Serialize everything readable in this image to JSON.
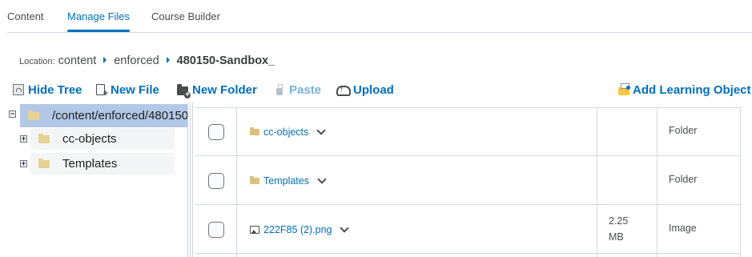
{
  "tabs": [
    {
      "label": "Content",
      "active": false
    },
    {
      "label": "Manage Files",
      "active": true
    },
    {
      "label": "Course Builder",
      "active": false
    }
  ],
  "breadcrumb": {
    "location_label": "Location:",
    "items": [
      "content",
      "enforced",
      "480150-Sandbox_"
    ]
  },
  "toolbar": {
    "hide_tree": "Hide Tree",
    "new_file": "New File",
    "new_folder": "New Folder",
    "paste": "Paste",
    "upload": "Upload",
    "add_learning_object": "Add Learning Object"
  },
  "tree": {
    "root": "/content/enforced/480150",
    "children": [
      "cc-objects",
      "Templates"
    ]
  },
  "files": [
    {
      "name": "cc-objects",
      "icon": "folder-icon",
      "size": "",
      "type": "Folder"
    },
    {
      "name": "Templates",
      "icon": "folder-icon",
      "size": "",
      "type": "Folder"
    },
    {
      "name": "222F85 (2).png",
      "icon": "image-icon",
      "size": "2.25 MB",
      "type": "Image"
    }
  ],
  "colors": {
    "accent": "#006fbf",
    "selected_tree": "#b3c8e6",
    "folder": "#e5d294"
  }
}
